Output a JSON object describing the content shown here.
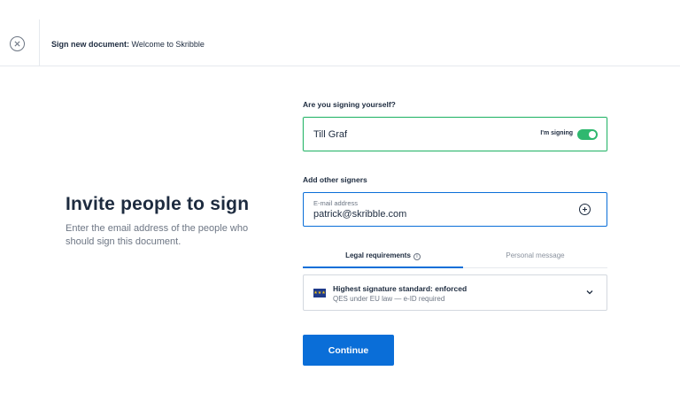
{
  "header": {
    "title_bold": "Sign new document:",
    "title_rest": "Welcome to Skribble"
  },
  "intro": {
    "heading": "Invite people to sign",
    "description": "Enter the email address of the people who should sign this document."
  },
  "self_signing": {
    "question": "Are you signing yourself?",
    "name": "Till Graf",
    "toggle_label": "I'm signing",
    "toggle_on": true
  },
  "other_signers": {
    "label": "Add other signers",
    "email_caption": "E-mail address",
    "email_value": "patrick@skribble.com"
  },
  "tabs": [
    {
      "label": "Legal requirements",
      "active": true
    },
    {
      "label": "Personal message",
      "active": false
    }
  ],
  "legal": {
    "title": "Highest signature standard: enforced",
    "subtitle": "QES under EU law — e-ID required",
    "flag_stars": "★★★"
  },
  "actions": {
    "continue_label": "Continue"
  },
  "colors": {
    "accent_blue": "#0a6ed8",
    "success_green": "#2fb86f",
    "text_dark": "#1d2b3f",
    "text_muted": "#6d7684"
  },
  "icons": {
    "close": "close-icon",
    "toggle": "toggle-icon",
    "add": "plus-circle-icon",
    "info": "info-icon",
    "flag": "eu-flag-icon",
    "chevron": "chevron-down-icon"
  }
}
